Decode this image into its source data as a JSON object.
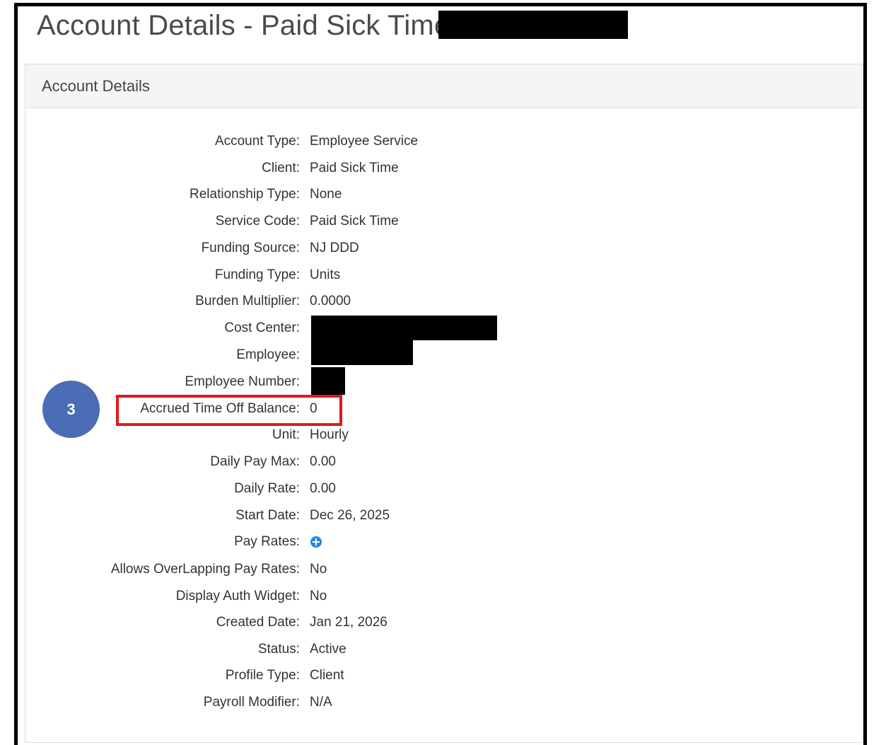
{
  "page": {
    "title": "Account Details - Paid Sick Time/"
  },
  "panel": {
    "heading": "Account Details"
  },
  "details": [
    {
      "label": "Account Type:",
      "value": "Employee Service"
    },
    {
      "label": "Client:",
      "value": "Paid Sick Time"
    },
    {
      "label": "Relationship Type:",
      "value": "None"
    },
    {
      "label": "Service Code:",
      "value": "Paid Sick Time"
    },
    {
      "label": "Funding Source:",
      "value": "NJ DDD"
    },
    {
      "label": "Funding Type:",
      "value": "Units"
    },
    {
      "label": "Burden Multiplier:",
      "value": "0.0000"
    },
    {
      "label": "Cost Center:",
      "value": ""
    },
    {
      "label": "Employee:",
      "value": ""
    },
    {
      "label": "Employee Number:",
      "value": ""
    },
    {
      "label": "Accrued Time Off Balance:",
      "value": "0"
    },
    {
      "label": "Unit:",
      "value": "Hourly"
    },
    {
      "label": "Daily Pay Max:",
      "value": "0.00"
    },
    {
      "label": "Daily Rate:",
      "value": "0.00"
    },
    {
      "label": "Start Date:",
      "value": "Dec 26, 2025"
    },
    {
      "label": "Pay Rates:",
      "value": ""
    },
    {
      "label": "Allows OverLapping Pay Rates:",
      "value": "No"
    },
    {
      "label": "Display Auth Widget:",
      "value": "No"
    },
    {
      "label": "Created Date:",
      "value": "Jan 21, 2026"
    },
    {
      "label": "Status:",
      "value": "Active"
    },
    {
      "label": "Profile Type:",
      "value": "Client"
    },
    {
      "label": "Payroll Modifier:",
      "value": "N/A"
    }
  ],
  "annotation": {
    "step_number": "3",
    "badge_color": "#4a6db5",
    "highlight_color": "#e01919"
  },
  "icons": {
    "pay_rates_add": "plus-circle-icon"
  },
  "colors": {
    "heading_bg": "#f5f5f5",
    "icon_blue": "#1e88e5"
  }
}
